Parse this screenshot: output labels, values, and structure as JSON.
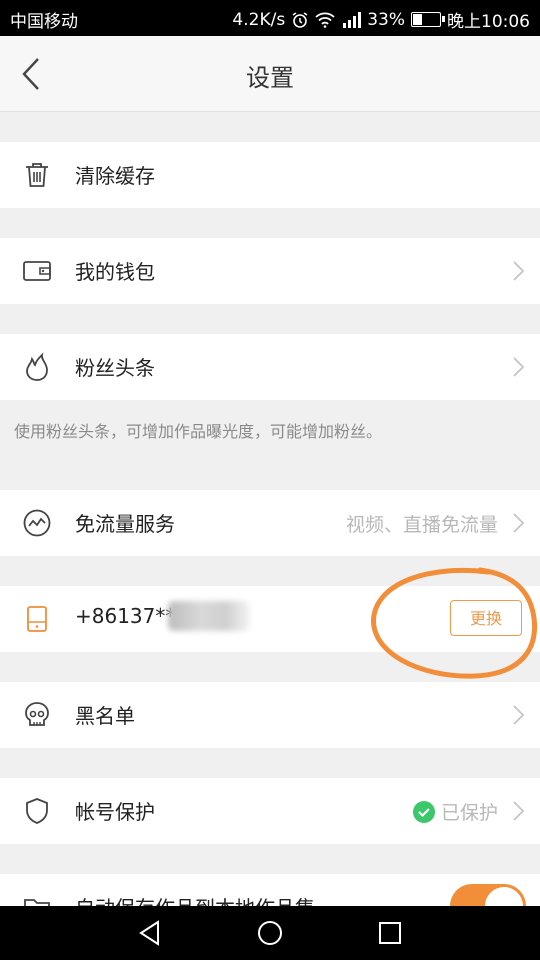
{
  "status_bar": {
    "carrier": "中国移动",
    "speed": "4.2K/s",
    "battery": "33%",
    "battery_level": 0.33,
    "time": "晚上10:06"
  },
  "header": {
    "title": "设置"
  },
  "rows": {
    "clear_cache": {
      "label": "清除缓存",
      "icon": "trash-icon"
    },
    "wallet": {
      "label": "我的钱包",
      "icon": "wallet-icon"
    },
    "fans_headline": {
      "label": "粉丝头条",
      "icon": "flame-icon",
      "hint": "使用粉丝头条，可增加作品曝光度，可能增加粉丝。"
    },
    "free_data": {
      "label": "免流量服务",
      "value": "视频、直播免流量",
      "icon": "wave-icon"
    },
    "phone": {
      "label": "+86137**",
      "button": "更换",
      "icon": "phone-icon"
    },
    "blacklist": {
      "label": "黑名单",
      "icon": "skull-icon"
    },
    "account_protect": {
      "label": "帐号保护",
      "value": "已保护",
      "icon": "shield-icon"
    },
    "auto_save": {
      "label": "自动保存作品到本地作品集",
      "icon": "folder-icon",
      "enabled": true
    }
  },
  "colors": {
    "accent": "#f28d3a",
    "ok": "#3cc76b",
    "background": "#f0f0f0"
  }
}
